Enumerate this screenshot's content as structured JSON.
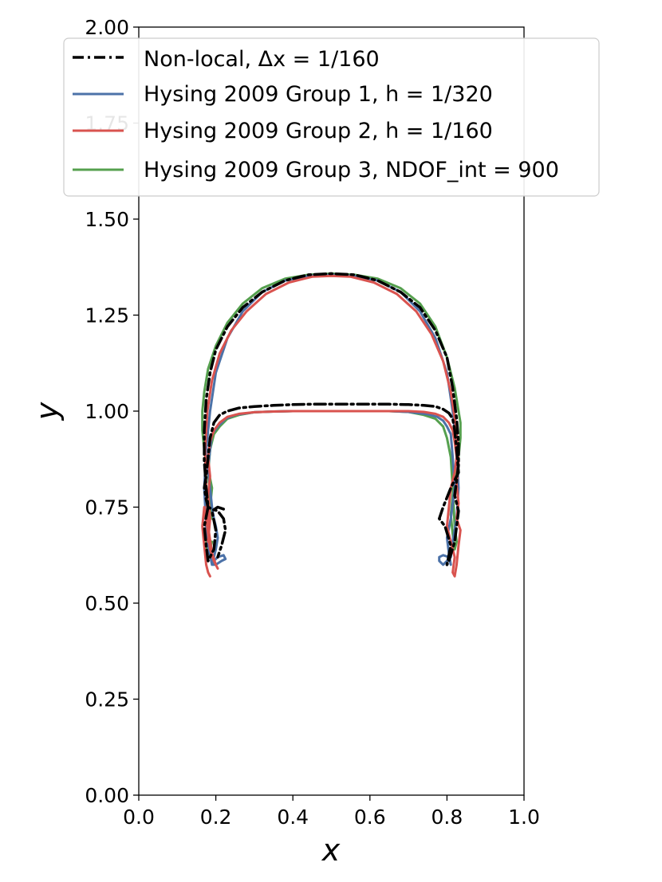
{
  "chart_data": {
    "type": "line",
    "xlabel": "x",
    "ylabel": "y",
    "xlim": [
      0.0,
      1.0
    ],
    "ylim": [
      0.0,
      2.0
    ],
    "xticks": [
      "0.0",
      "0.2",
      "0.4",
      "0.6",
      "0.8",
      "1.0"
    ],
    "yticks": [
      "0.00",
      "0.25",
      "0.50",
      "0.75",
      "1.00",
      "1.25",
      "1.50",
      "1.75",
      "2.00"
    ],
    "grid": false,
    "legend_position": "top",
    "series": [
      {
        "name": "Non-local, Δx = 1/160",
        "color": "#000000",
        "style": "dash-dot",
        "x": [
          0.22,
          0.205,
          0.19,
          0.2,
          0.195,
          0.18,
          0.175,
          0.17,
          0.18,
          0.175,
          0.17,
          0.17,
          0.175,
          0.185,
          0.2,
          0.23,
          0.27,
          0.32,
          0.38,
          0.44,
          0.5,
          0.56,
          0.62,
          0.68,
          0.73,
          0.77,
          0.8,
          0.815,
          0.825,
          0.83,
          0.83,
          0.825,
          0.82,
          0.83,
          0.825,
          0.82,
          0.805,
          0.8,
          0.81,
          0.795,
          0.78,
          0.79,
          0.81,
          0.83,
          0.825,
          0.82,
          0.815,
          0.805,
          0.79,
          0.77,
          0.74,
          0.7,
          0.65,
          0.6,
          0.55,
          0.5,
          0.45,
          0.4,
          0.35,
          0.3,
          0.26,
          0.23,
          0.21,
          0.195,
          0.185,
          0.18,
          0.175,
          0.17,
          0.175,
          0.18,
          0.19,
          0.205,
          0.22,
          0.225,
          0.215,
          0.205
        ],
        "y": [
          0.745,
          0.75,
          0.74,
          0.69,
          0.64,
          0.61,
          0.65,
          0.7,
          0.75,
          0.8,
          0.87,
          0.95,
          1.03,
          1.1,
          1.16,
          1.22,
          1.27,
          1.31,
          1.34,
          1.355,
          1.358,
          1.355,
          1.34,
          1.31,
          1.27,
          1.21,
          1.14,
          1.06,
          0.98,
          0.92,
          0.86,
          0.82,
          0.78,
          0.74,
          0.7,
          0.66,
          0.61,
          0.6,
          0.65,
          0.7,
          0.72,
          0.75,
          0.8,
          0.84,
          0.9,
          0.95,
          0.98,
          0.995,
          1.005,
          1.012,
          1.015,
          1.017,
          1.018,
          1.018,
          1.018,
          1.018,
          1.018,
          1.017,
          1.015,
          1.012,
          1.008,
          1.0,
          0.99,
          0.97,
          0.93,
          0.88,
          0.83,
          0.8,
          0.77,
          0.75,
          0.745,
          0.74,
          0.72,
          0.69,
          0.65,
          0.62
        ]
      },
      {
        "name": "Hysing 2009 Group 1, h = 1/320",
        "color": "#4c72a8",
        "style": "solid",
        "x": [
          0.19,
          0.2,
          0.215,
          0.225,
          0.22,
          0.205,
          0.195,
          0.19,
          0.18,
          0.175,
          0.17,
          0.175,
          0.185,
          0.2,
          0.23,
          0.27,
          0.32,
          0.38,
          0.44,
          0.5,
          0.56,
          0.62,
          0.68,
          0.73,
          0.77,
          0.8,
          0.815,
          0.825,
          0.83,
          0.825,
          0.815,
          0.81,
          0.8,
          0.79,
          0.78,
          0.78,
          0.79,
          0.805,
          0.81,
          0.805,
          0.8,
          0.81,
          0.82,
          0.815,
          0.81,
          0.8,
          0.79,
          0.775,
          0.75,
          0.7,
          0.65,
          0.6,
          0.55,
          0.5,
          0.45,
          0.4,
          0.35,
          0.3,
          0.25,
          0.225,
          0.205,
          0.19,
          0.185,
          0.18,
          0.185,
          0.19,
          0.195,
          0.2,
          0.205,
          0.2,
          0.195,
          0.19
        ],
        "y": [
          0.6,
          0.6,
          0.61,
          0.615,
          0.625,
          0.62,
          0.61,
          0.6,
          0.65,
          0.7,
          0.8,
          0.9,
          1.0,
          1.1,
          1.19,
          1.26,
          1.31,
          1.34,
          1.352,
          1.355,
          1.352,
          1.34,
          1.31,
          1.26,
          1.19,
          1.1,
          1.0,
          0.9,
          0.8,
          0.72,
          0.66,
          0.62,
          0.61,
          0.6,
          0.61,
          0.62,
          0.625,
          0.62,
          0.6,
          0.63,
          0.67,
          0.72,
          0.8,
          0.88,
          0.94,
          0.96,
          0.975,
          0.985,
          0.992,
          0.998,
          1.0,
          1.0,
          1.0,
          1.0,
          1.0,
          1.0,
          0.999,
          0.997,
          0.99,
          0.98,
          0.96,
          0.94,
          0.9,
          0.85,
          0.8,
          0.75,
          0.72,
          0.7,
          0.67,
          0.64,
          0.62,
          0.6
        ]
      },
      {
        "name": "Hysing 2009 Group 2, h = 1/160",
        "color": "#d9534f",
        "style": "solid",
        "x": [
          0.185,
          0.18,
          0.175,
          0.17,
          0.165,
          0.17,
          0.175,
          0.18,
          0.185,
          0.195,
          0.205,
          0.2,
          0.19,
          0.18,
          0.175,
          0.172,
          0.178,
          0.19,
          0.21,
          0.24,
          0.28,
          0.33,
          0.39,
          0.45,
          0.5,
          0.55,
          0.61,
          0.67,
          0.72,
          0.76,
          0.79,
          0.81,
          0.822,
          0.828,
          0.83,
          0.825,
          0.83,
          0.825,
          0.835,
          0.83,
          0.825,
          0.82,
          0.815,
          0.82,
          0.81,
          0.8,
          0.805,
          0.81,
          0.82,
          0.825,
          0.82,
          0.815,
          0.805,
          0.79,
          0.77,
          0.74,
          0.7,
          0.65,
          0.6,
          0.55,
          0.5,
          0.45,
          0.4,
          0.35,
          0.3,
          0.26,
          0.23,
          0.21,
          0.195,
          0.185,
          0.18,
          0.185,
          0.18,
          0.185,
          0.18
        ],
        "y": [
          0.57,
          0.58,
          0.6,
          0.65,
          0.7,
          0.75,
          0.72,
          0.68,
          0.64,
          0.61,
          0.59,
          0.6,
          0.63,
          0.7,
          0.8,
          0.9,
          1.0,
          1.08,
          1.15,
          1.21,
          1.26,
          1.305,
          1.335,
          1.35,
          1.352,
          1.35,
          1.335,
          1.305,
          1.26,
          1.2,
          1.13,
          1.05,
          0.97,
          0.91,
          0.86,
          0.81,
          0.76,
          0.72,
          0.69,
          0.65,
          0.6,
          0.57,
          0.58,
          0.62,
          0.66,
          0.7,
          0.75,
          0.8,
          0.84,
          0.88,
          0.92,
          0.95,
          0.97,
          0.985,
          0.993,
          0.998,
          1.0,
          1.0,
          1.0,
          1.0,
          1.0,
          1.0,
          1.0,
          0.999,
          0.997,
          0.993,
          0.985,
          0.97,
          0.95,
          0.92,
          0.88,
          0.83,
          0.78,
          0.72,
          0.66
        ]
      },
      {
        "name": "Hysing 2009 Group 3, NDOF_int = 900",
        "color": "#55a04e",
        "style": "solid",
        "x": [
          0.19,
          0.185,
          0.18,
          0.175,
          0.18,
          0.185,
          0.19,
          0.18,
          0.17,
          0.165,
          0.165,
          0.17,
          0.18,
          0.2,
          0.23,
          0.27,
          0.32,
          0.38,
          0.44,
          0.5,
          0.56,
          0.62,
          0.68,
          0.73,
          0.77,
          0.8,
          0.82,
          0.83,
          0.835,
          0.835,
          0.83,
          0.82,
          0.815,
          0.81,
          0.815,
          0.82,
          0.825,
          0.82,
          0.815,
          0.81,
          0.8,
          0.79,
          0.77,
          0.74,
          0.7,
          0.65,
          0.6,
          0.55,
          0.5,
          0.45,
          0.4,
          0.35,
          0.3,
          0.26,
          0.23,
          0.21,
          0.195,
          0.185,
          0.18,
          0.185,
          0.19
        ],
        "y": [
          0.66,
          0.64,
          0.63,
          0.65,
          0.7,
          0.75,
          0.8,
          0.85,
          0.9,
          0.95,
          1.0,
          1.05,
          1.11,
          1.17,
          1.23,
          1.28,
          1.32,
          1.345,
          1.355,
          1.358,
          1.355,
          1.345,
          1.32,
          1.28,
          1.22,
          1.14,
          1.06,
          1.0,
          0.97,
          0.93,
          0.88,
          0.83,
          0.78,
          0.73,
          0.68,
          0.64,
          0.66,
          0.7,
          0.8,
          0.88,
          0.93,
          0.96,
          0.98,
          0.99,
          0.998,
          1.0,
          1.0,
          1.0,
          1.0,
          1.0,
          1.0,
          0.999,
          0.997,
          0.99,
          0.98,
          0.96,
          0.94,
          0.9,
          0.84,
          0.78,
          0.72
        ]
      }
    ]
  }
}
